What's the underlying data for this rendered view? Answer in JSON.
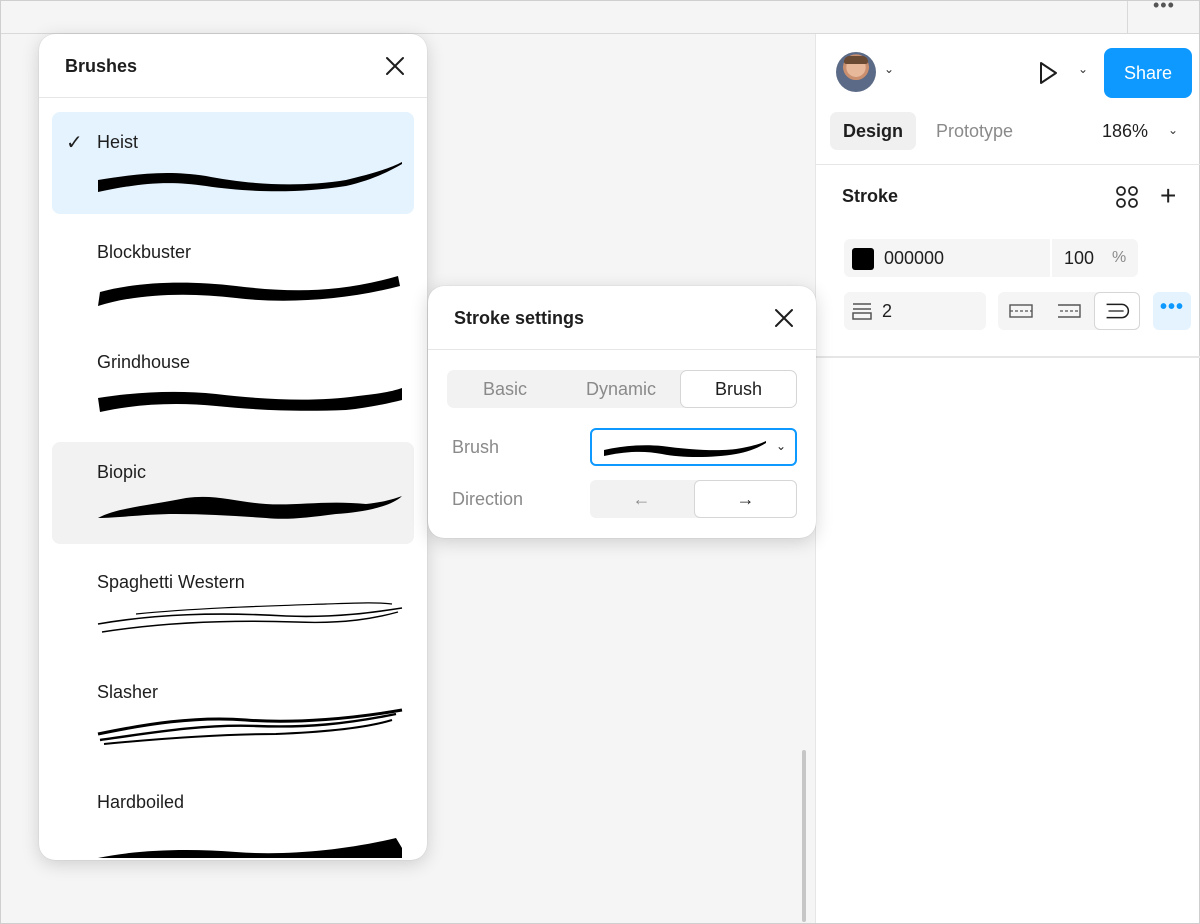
{
  "top_bar": {
    "menu_icon": "more-dots-icon"
  },
  "right_panel": {
    "avatar_icon": "user-avatar",
    "play_icon": "play-icon",
    "share_label": "Share",
    "tabs": [
      {
        "label": "Design",
        "active": true
      },
      {
        "label": "Prototype",
        "active": false
      }
    ],
    "zoom": "186%",
    "stroke": {
      "title": "Stroke",
      "color_hex": "000000",
      "opacity": "100",
      "opacity_unit": "%",
      "weight": "2",
      "swatch_color": "#000000"
    },
    "accent_color": "#0d99ff"
  },
  "brushes_panel": {
    "title": "Brushes",
    "items": [
      {
        "name": "Heist",
        "selected": true,
        "check": "✓"
      },
      {
        "name": "Blockbuster",
        "selected": false
      },
      {
        "name": "Grindhouse",
        "selected": false
      },
      {
        "name": "Biopic",
        "selected": false,
        "hovered": true
      },
      {
        "name": "Spaghetti Western",
        "selected": false
      },
      {
        "name": "Slasher",
        "selected": false
      },
      {
        "name": "Hardboiled",
        "selected": false
      }
    ]
  },
  "stroke_settings": {
    "title": "Stroke settings",
    "tabs": [
      {
        "label": "Basic",
        "active": false
      },
      {
        "label": "Dynamic",
        "active": false
      },
      {
        "label": "Brush",
        "active": true
      }
    ],
    "brush_label": "Brush",
    "direction_label": "Direction",
    "direction_options": [
      {
        "label": "←",
        "active": false
      },
      {
        "label": "→",
        "active": true
      }
    ]
  }
}
